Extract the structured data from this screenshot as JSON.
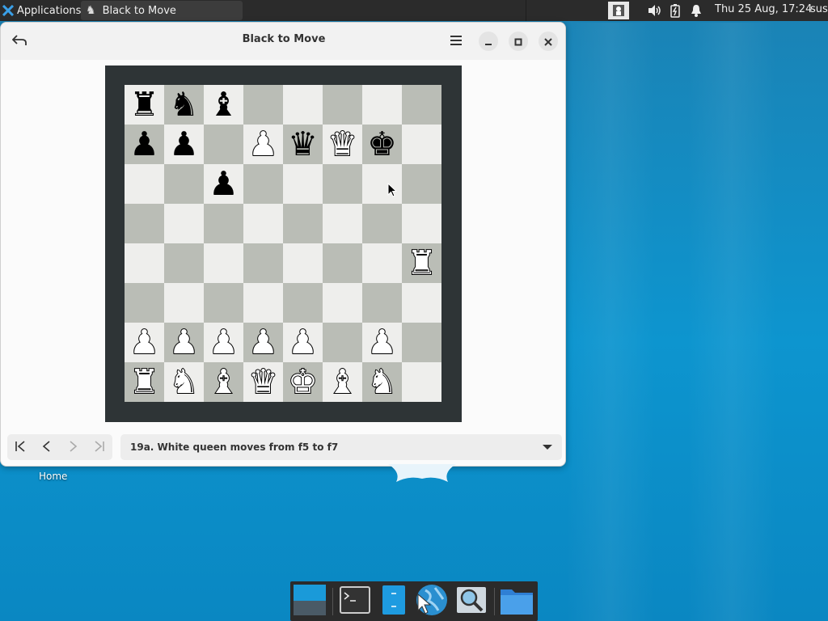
{
  "top_panel": {
    "applications_label": "Applications",
    "task_title": "Black to Move",
    "clock": "Thu 25 Aug, 17:24",
    "user": "sus"
  },
  "window": {
    "title": "Black to Move"
  },
  "board": {
    "ranks": [
      [
        "r",
        "n",
        "b",
        "",
        "",
        "",
        "",
        ""
      ],
      [
        "p",
        "p",
        "",
        "P",
        "q",
        "Q",
        "k",
        ""
      ],
      [
        "",
        "",
        "p",
        "",
        "",
        "",
        "",
        ""
      ],
      [
        "",
        "",
        "",
        "",
        "",
        "",
        "",
        ""
      ],
      [
        "",
        "",
        "",
        "",
        "",
        "",
        "",
        "R"
      ],
      [
        "",
        "",
        "",
        "",
        "",
        "",
        "",
        ""
      ],
      [
        "P",
        "P",
        "P",
        "P",
        "P",
        "",
        "P",
        ""
      ],
      [
        "R",
        "N",
        "B",
        "Q",
        "K",
        "B",
        "N",
        ""
      ]
    ]
  },
  "move_history": {
    "selected": "19a. White queen moves from f5 to f7"
  },
  "desktop": {
    "home_label": "Home"
  },
  "colors": {
    "light_square": "#eeeeec",
    "dark_square": "#babdb6",
    "board_frame": "#2e3436"
  }
}
